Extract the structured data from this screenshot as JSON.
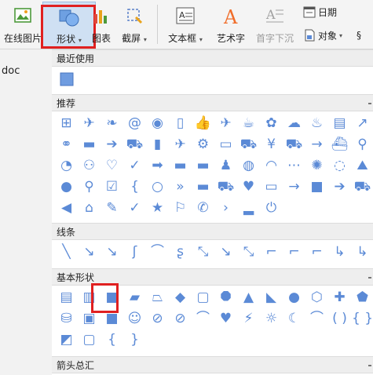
{
  "toolbar": {
    "online_picture": "在线图片",
    "shape": "形状",
    "chart": "图表",
    "screenshot": "截屏",
    "textbox": "文本框",
    "wordart": "艺术字",
    "dropcap": "首字下沉",
    "date": "日期",
    "object": "对象",
    "more": "§"
  },
  "document": {
    "name_fragment": "doc"
  },
  "panel": {
    "recent": {
      "title": "最近使用",
      "icons": [
        "rectangle-icon"
      ]
    },
    "recommended": {
      "title": "推荐",
      "glyphs": [
        "⊞",
        "✈",
        "❧",
        "@",
        "◉",
        "▯",
        "👍",
        "✈",
        "☕",
        "✿",
        "☁",
        "♨",
        "▤",
        "↗",
        "⚭",
        "▬",
        "➔",
        "⛟",
        "▮",
        "✈",
        "⚙",
        "▭",
        "⛟",
        "¥",
        "⛟",
        "→",
        "⛴",
        "⚲",
        "◔",
        "⚇",
        "♡",
        "✓",
        "➡",
        "▬",
        "▬",
        "♟",
        "◍",
        "◠",
        "⋯",
        "✺",
        "◌",
        "⛰",
        "●",
        "⚲",
        "☑",
        "{",
        "○",
        "»",
        "▬",
        "⛟",
        "♥",
        "▭",
        "→",
        "■",
        "➔",
        "⛟",
        "◀",
        "⌂",
        "✎",
        "✓",
        "★",
        "⚐",
        "✆",
        "›",
        "▂",
        "⏻"
      ]
    },
    "lines": {
      "title": "线条",
      "glyphs": [
        "╲",
        "↘",
        "↘",
        "ʃ",
        "⌒",
        "ʂ",
        "⤡",
        "↘",
        "⤡",
        "⌐",
        "⌐",
        "⌐",
        "↳",
        "↳"
      ]
    },
    "basic": {
      "title": "基本形状",
      "glyphs": [
        "▤",
        "▥",
        "■",
        "▰",
        "⏢",
        "◆",
        "▢",
        "⯃",
        "▲",
        "◣",
        "●",
        "⬡",
        "✚",
        "⬟",
        "⛁",
        "▣",
        "■",
        "☺",
        "⊘",
        "⊘",
        "⌒",
        "♥",
        "⚡",
        "☼",
        "☾",
        "⌒",
        "( )",
        "{ }",
        "◩",
        "▢",
        "{",
        "}"
      ]
    },
    "arrows": {
      "title": "箭头总汇"
    }
  }
}
